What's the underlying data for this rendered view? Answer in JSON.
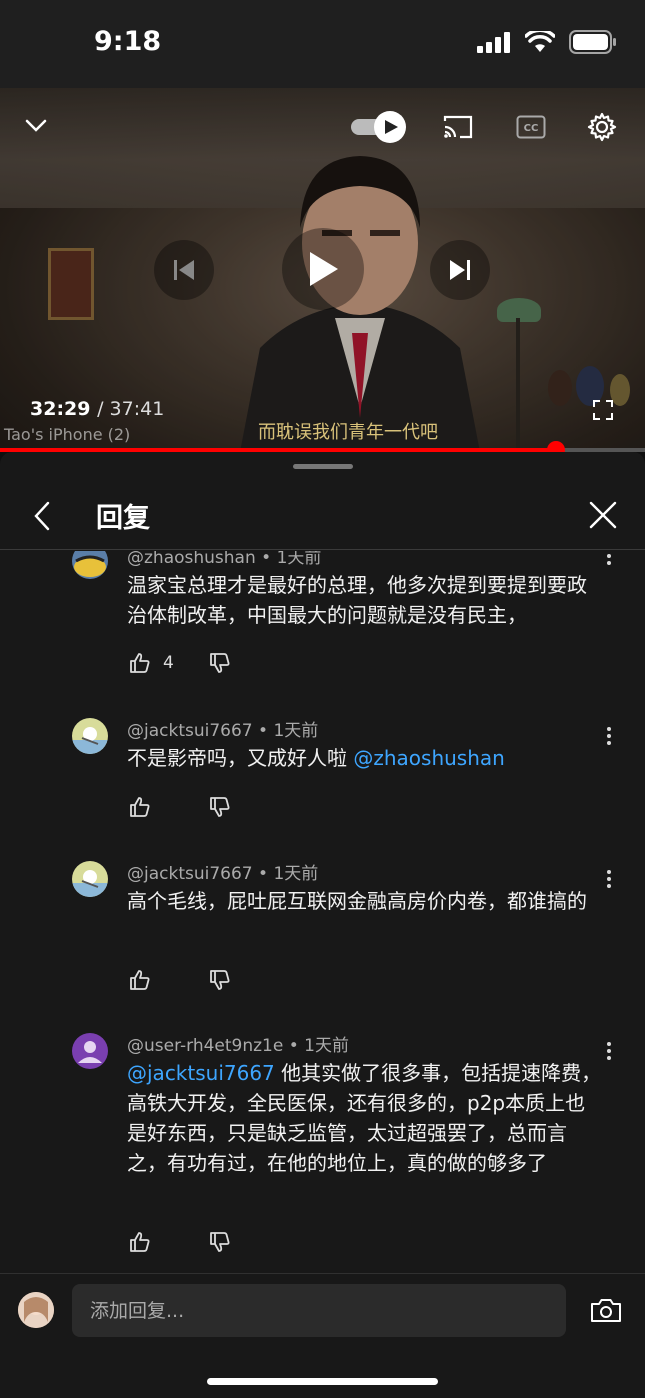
{
  "status_bar": {
    "time": "9:18"
  },
  "player": {
    "current_time": "32:29",
    "duration": "/ 37:41",
    "device_label": "Tao's iPhone (2)",
    "subtitle": "而耽误我们青年一代吧",
    "progress_fraction": 0.862,
    "autoplay_on": true
  },
  "panel": {
    "title": "回复"
  },
  "comments": [
    {
      "author": "@zhaoshushan",
      "time": "1天前",
      "body": "温家宝总理才是最好的总理，他多次提到要提到要政治体制改革，中国最大的问题就是没有民主，",
      "likes": "4"
    },
    {
      "author": "@jacktsui7667",
      "time": "1天前",
      "body": "不是影帝吗，又成好人啦 ",
      "mention": "@zhaoshushan",
      "likes": ""
    },
    {
      "author": "@jacktsui7667",
      "time": "1天前",
      "body": "高个毛线，屁吐屁互联网金融高房价内卷，都谁搞的",
      "likes": ""
    },
    {
      "author": "@user-rh4et9nz1e",
      "time": "1天前",
      "mention": " @jacktsui7667",
      "body": " 他其实做了很多事，包括提速降费，高铁大开发，全民医保，还有很多的，p2p本质上也是好东西，只是缺乏监管，太过超强罢了，总而言之，有功有过，在他的地位上，真的做的够多了",
      "likes": ""
    }
  ],
  "reply_bar": {
    "placeholder": "添加回复..."
  },
  "colors": {
    "accent_red": "#ff0000",
    "link_blue": "#3ea6ff",
    "panel_bg": "#181818"
  },
  "icons": [
    "collapse-chevron-icon",
    "autoplay-toggle-icon",
    "cast-icon",
    "captions-icon",
    "settings-gear-icon",
    "previous-icon",
    "play-icon",
    "next-icon",
    "fullscreen-icon",
    "back-arrow-icon",
    "close-icon",
    "like-icon",
    "dislike-icon",
    "more-options-icon",
    "camera-icon"
  ]
}
